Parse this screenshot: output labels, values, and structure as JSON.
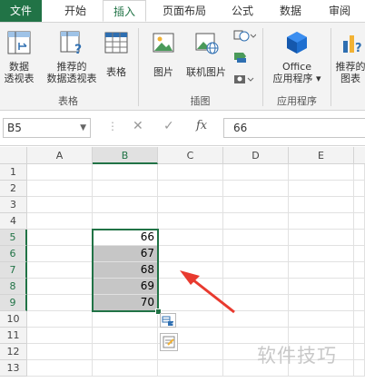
{
  "tabs": [
    "文件",
    "开始",
    "插入",
    "页面布局",
    "公式",
    "数据",
    "审阅"
  ],
  "ribbon": {
    "pivot_l1": "数据",
    "pivot_l2": "透视表",
    "rec_pivot_l1": "推荐的",
    "rec_pivot_l2": "数据透视表",
    "table": "表格",
    "group_table": "表格",
    "picture": "图片",
    "online_picture": "联机图片",
    "group_illustrations": "插图",
    "office_l1": "Office",
    "office_l2": "应用程序 ▾",
    "group_apps": "应用程序",
    "rec_chart_l1": "推荐的",
    "rec_chart_l2": "图表"
  },
  "formula_bar": {
    "name_box": "B5",
    "cancel": "✕",
    "enter": "✓",
    "fx": "fx",
    "value": "66"
  },
  "columns": [
    "A",
    "B",
    "C",
    "D",
    "E"
  ],
  "rows": [
    "1",
    "2",
    "3",
    "4",
    "5",
    "6",
    "7",
    "8",
    "9",
    "10",
    "11",
    "12",
    "13"
  ],
  "cells": {
    "B5": "66",
    "B6": "67",
    "B7": "68",
    "B8": "69",
    "B9": "70"
  },
  "watermark": "软件技巧",
  "colors": {
    "accent": "#217346",
    "selection_fill": "#c6c6c6",
    "arrow": "#e83a2f"
  }
}
